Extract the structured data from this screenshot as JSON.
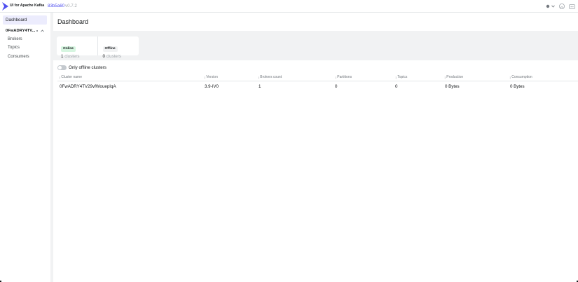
{
  "app": {
    "brand": "UI for Apache Kafka",
    "version_hash": "83b5a60",
    "version_number": "v0.7.2",
    "accent_color": "#4f4ff0"
  },
  "top_actions": {
    "theme_icon": "sun-icon",
    "github_icon": "github-icon",
    "discord_icon": "discord-icon"
  },
  "sidebar": {
    "dashboard_label": "Dashboard",
    "cluster_name": "0FwADRY4TV...",
    "items": [
      {
        "label": "Brokers"
      },
      {
        "label": "Topics"
      },
      {
        "label": "Consumers"
      }
    ]
  },
  "page": {
    "title": "Dashboard"
  },
  "metrics": {
    "online": {
      "badge": "Online",
      "value": "1",
      "unit": "clusters"
    },
    "offline": {
      "badge": "Offline",
      "value": "0",
      "unit": "clusters"
    }
  },
  "filter": {
    "switch_label": "Only offline clusters",
    "checked": false
  },
  "table": {
    "columns": [
      "Cluster name",
      "Version",
      "Brokers count",
      "Partitions",
      "Topics",
      "Production",
      "Consumption"
    ],
    "rows": [
      [
        "0FwADRY4TV29vfWouepIqA",
        "3.9-IV0",
        "1",
        "0",
        "0",
        "0 Bytes",
        "0 Bytes"
      ]
    ]
  }
}
